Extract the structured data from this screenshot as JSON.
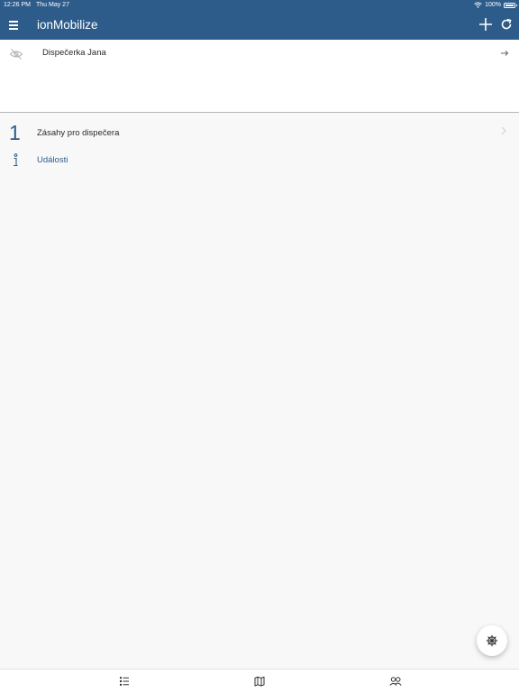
{
  "status_bar": {
    "time": "12:26 PM",
    "date": "Thu May 27",
    "battery": "100%"
  },
  "app_bar": {
    "title": "ionMobilize",
    "icons": [
      "menu-icon",
      "plus-icon",
      "refresh-icon"
    ]
  },
  "user": {
    "name": "Dispečerka Jana",
    "icons": [
      "eye-slash-icon",
      "arrow-right-icon"
    ]
  },
  "list": {
    "items": [
      {
        "count": "1",
        "label": "Zásahy pro dispečera",
        "icon": "chevron-right-icon"
      },
      {
        "label": "Události",
        "icon": "info-icon"
      }
    ]
  },
  "fab": {
    "icon": "helm-icon"
  },
  "bottom_nav": {
    "items": [
      {
        "icon": "list-icon"
      },
      {
        "icon": "map-icon"
      },
      {
        "icon": "people-icon"
      }
    ]
  },
  "colors": {
    "primary": "#2d5c8b",
    "background": "#f8f8f9",
    "surface": "#ffffff",
    "divider": "#b8b8b8"
  }
}
